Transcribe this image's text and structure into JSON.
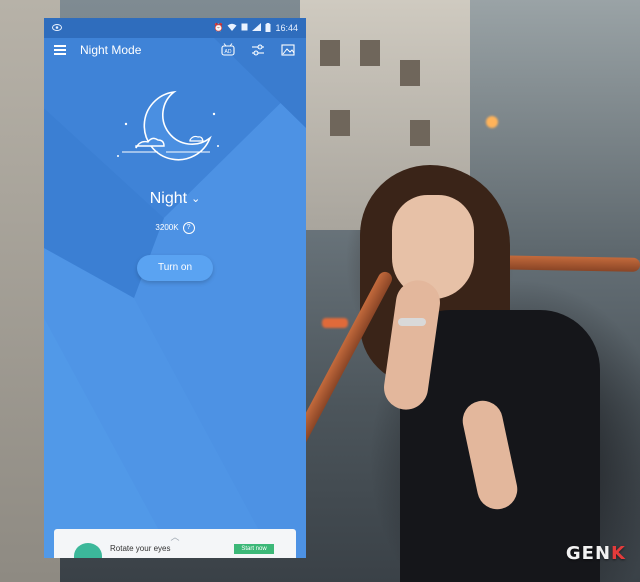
{
  "status_bar": {
    "time": "16:44",
    "icons": [
      "eye-icon",
      "alarm-icon",
      "wifi-icon",
      "sim-icon",
      "signal-icon",
      "battery-icon"
    ]
  },
  "app_bar": {
    "title": "Night Mode",
    "icons": [
      "menu-icon",
      "ad-badge-icon",
      "sliders-icon",
      "image-icon"
    ],
    "ad_badge": "AD"
  },
  "mode": {
    "name": "Night",
    "temperature": "3200K"
  },
  "turn_on_button": {
    "label": "Turn on"
  },
  "ad_card": {
    "text": "Rotate your eyes",
    "button": "Start now"
  },
  "watermark": {
    "main": "GEN",
    "accent": "K"
  },
  "colors": {
    "app_bg": "#4a8fe1",
    "status_bar": "#2f6dbd",
    "button": "#5aa3f2",
    "watermark_accent": "#e33b3b"
  }
}
